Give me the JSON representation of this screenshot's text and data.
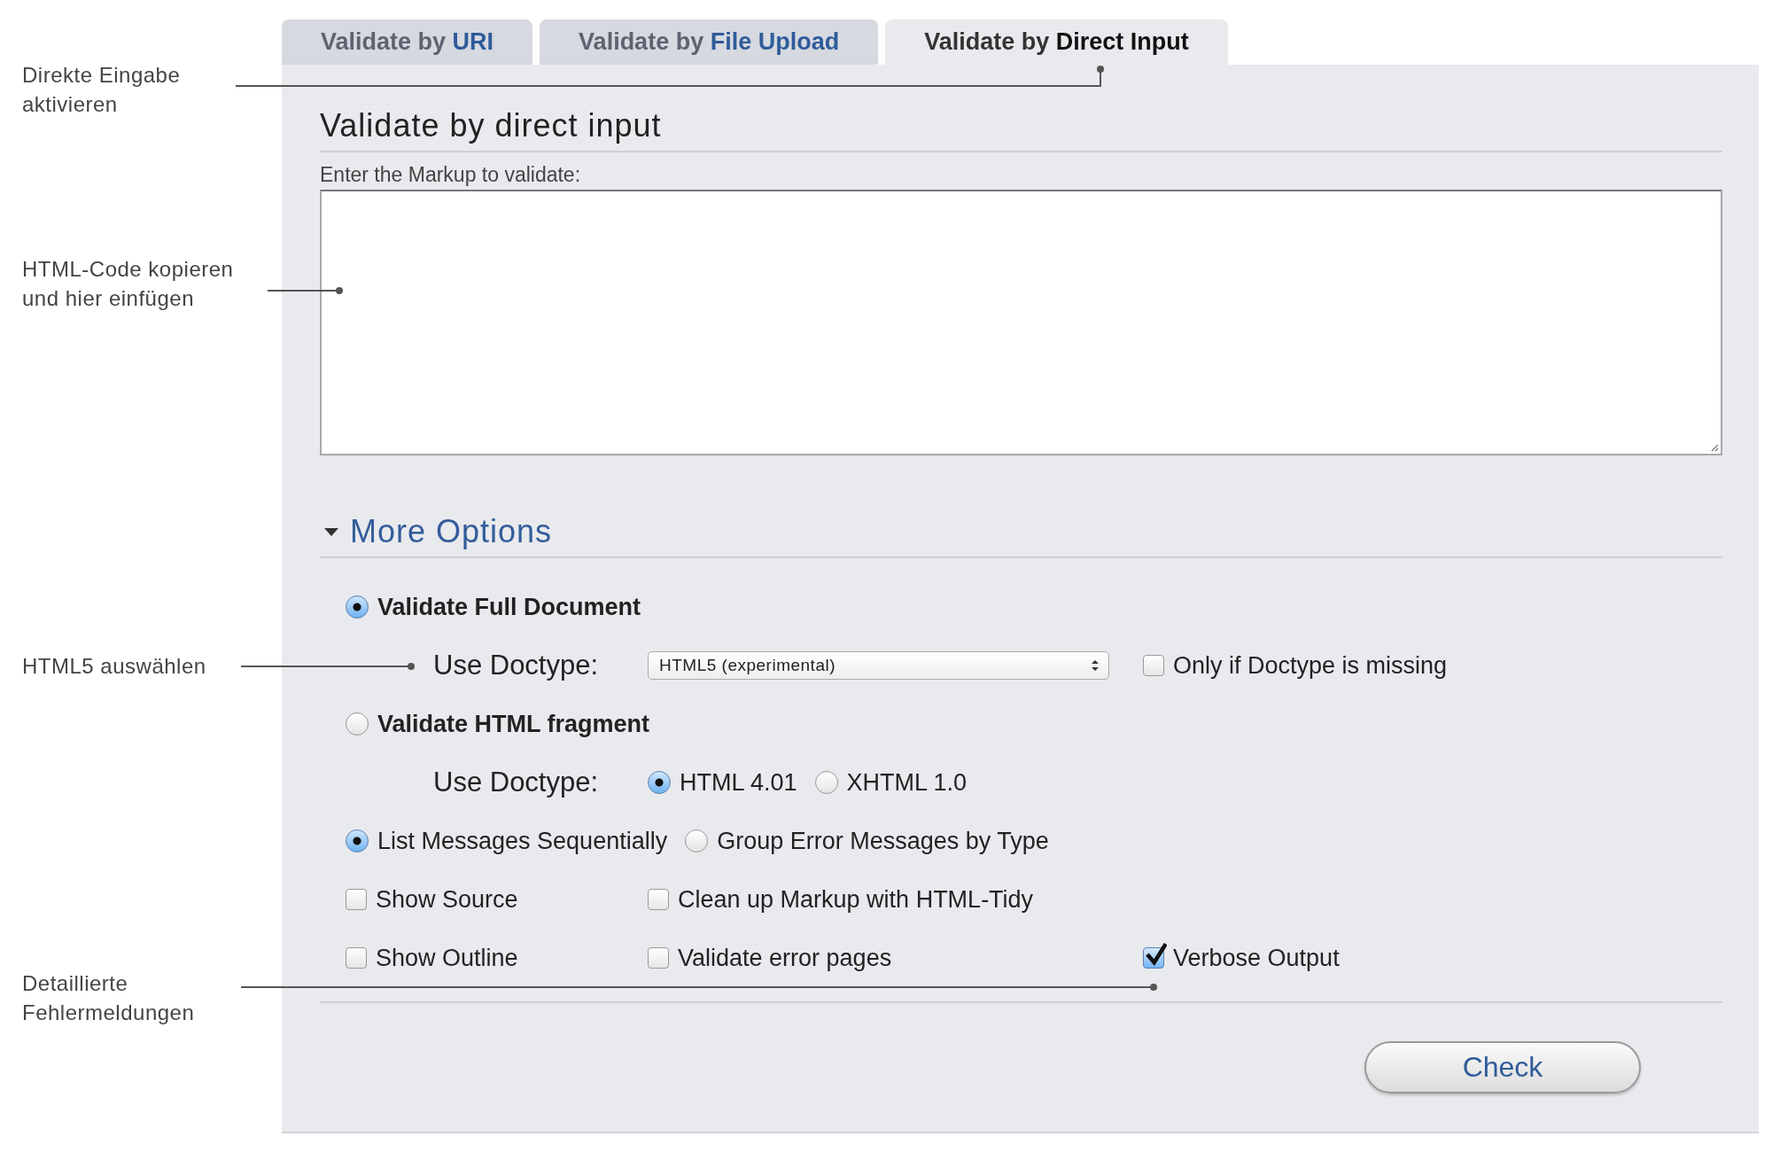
{
  "annotations": [
    {
      "lines": [
        "Direkte Eingabe",
        "aktivieren"
      ]
    },
    {
      "lines": [
        "HTML-Code kopieren",
        "und hier einfügen"
      ]
    },
    {
      "lines": [
        "HTML5 auswählen"
      ]
    },
    {
      "lines": [
        "Detaillierte",
        "Fehlermeldungen"
      ]
    }
  ],
  "tabs": [
    {
      "prefix": "Validate by",
      "name": "URI",
      "selected": false
    },
    {
      "prefix": "Validate by",
      "name": "File Upload",
      "selected": false
    },
    {
      "prefix": "Validate by",
      "name": "Direct Input",
      "selected": true
    }
  ],
  "heading": "Validate by direct input",
  "markup_label": "Enter the Markup to validate:",
  "more_options": {
    "label": "More Options",
    "expanded": true
  },
  "validate_modes": [
    {
      "label": "Validate Full Document",
      "selected": true
    },
    {
      "label": "Validate HTML fragment",
      "selected": false
    }
  ],
  "doctype": {
    "label": "Use Doctype:",
    "value": "HTML5 (experimental)"
  },
  "only_if_missing": {
    "label": "Only if Doctype is missing",
    "checked": false
  },
  "fragment_doctype": {
    "label": "Use Doctype:",
    "options": [
      {
        "label": "HTML 4.01",
        "selected": true
      },
      {
        "label": "XHTML 1.0",
        "selected": false
      }
    ]
  },
  "message_modes": [
    {
      "label": "List Messages Sequentially",
      "selected": true
    },
    {
      "label": "Group Error Messages by Type",
      "selected": false
    }
  ],
  "checkbox_rows": [
    [
      {
        "label": "Show Source",
        "checked": false
      },
      {
        "label": "Clean up Markup with HTML-Tidy",
        "checked": false
      }
    ],
    [
      {
        "label": "Show Outline",
        "checked": false
      },
      {
        "label": "Validate error pages",
        "checked": false
      },
      {
        "label": "Verbose Output",
        "checked": true
      }
    ]
  ],
  "button": "Check"
}
